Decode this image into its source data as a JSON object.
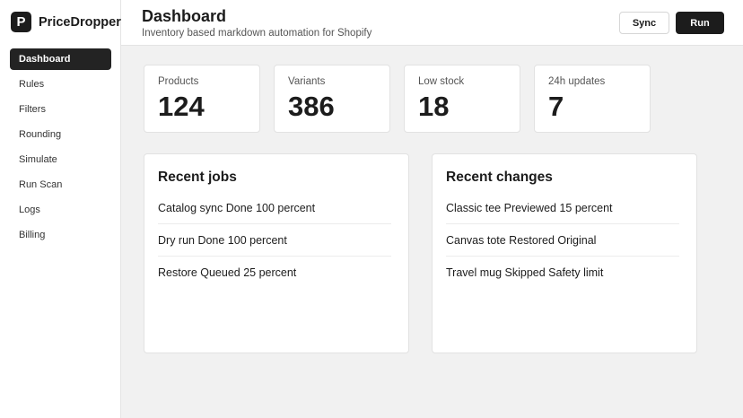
{
  "brand": {
    "logo_letter": "P",
    "name": "PriceDropper"
  },
  "nav": {
    "items": [
      {
        "label": "Dashboard",
        "active": true
      },
      {
        "label": "Rules"
      },
      {
        "label": "Filters"
      },
      {
        "label": "Rounding"
      },
      {
        "label": "Simulate"
      },
      {
        "label": "Run Scan"
      },
      {
        "label": "Logs"
      },
      {
        "label": "Billing"
      }
    ]
  },
  "header": {
    "title": "Dashboard",
    "subtitle": "Inventory based markdown automation for Shopify",
    "sync_label": "Sync",
    "run_label": "Run"
  },
  "stats": [
    {
      "label": "Products",
      "value": "124"
    },
    {
      "label": "Variants",
      "value": "386"
    },
    {
      "label": "Low stock",
      "value": "18"
    },
    {
      "label": "24h updates",
      "value": "7"
    }
  ],
  "recent_jobs": {
    "title": "Recent jobs",
    "items": [
      "Catalog sync Done 100 percent",
      "Dry run Done 100 percent",
      "Restore Queued 25 percent"
    ]
  },
  "recent_changes": {
    "title": "Recent changes",
    "items": [
      "Classic tee Previewed 15 percent",
      "Canvas tote Restored Original",
      "Travel mug Skipped Safety limit"
    ]
  },
  "colors": {
    "accent": "#1c1c1c",
    "background": "#f1f1f1",
    "surface": "#ffffff"
  }
}
